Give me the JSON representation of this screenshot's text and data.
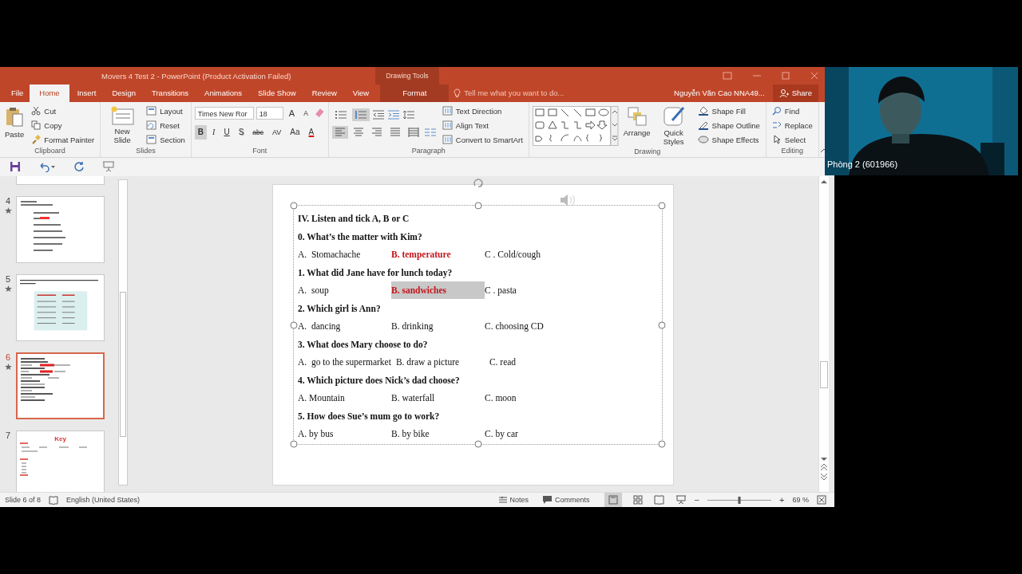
{
  "window": {
    "title": "Movers 4 Test 2 - PowerPoint (Product Activation Failed)",
    "context_title": "Drawing Tools"
  },
  "tabs": [
    {
      "label": "File",
      "selected": false,
      "kind": "standard"
    },
    {
      "label": "Home",
      "selected": true,
      "kind": "standard"
    },
    {
      "label": "Insert",
      "selected": false,
      "kind": "standard"
    },
    {
      "label": "Design",
      "selected": false,
      "kind": "standard"
    },
    {
      "label": "Transitions",
      "selected": false,
      "kind": "standard"
    },
    {
      "label": "Animations",
      "selected": false,
      "kind": "standard"
    },
    {
      "label": "Slide Show",
      "selected": false,
      "kind": "standard"
    },
    {
      "label": "Review",
      "selected": false,
      "kind": "standard"
    },
    {
      "label": "View",
      "selected": false,
      "kind": "standard"
    },
    {
      "label": "Format",
      "selected": false,
      "kind": "contextual"
    }
  ],
  "tell_me": {
    "placeholder": "Tell me what you want to do..."
  },
  "user": "Nguyễn Văn Cao NNA49...",
  "share": "Share",
  "ribbon": {
    "clipboard": {
      "label": "Clipboard",
      "paste": "Paste",
      "items": [
        "Cut",
        "Copy",
        "Format Painter"
      ]
    },
    "slides": {
      "label": "Slides",
      "new_slide": "New Slide",
      "items": [
        "Layout",
        "Reset",
        "Section"
      ]
    },
    "font": {
      "label": "Font",
      "font_name": "Times New Ror",
      "font_size": "18",
      "size_buttons": [
        "A",
        "A"
      ],
      "buttons": [
        {
          "label": "B",
          "on": true
        },
        {
          "label": "I",
          "on": false
        },
        {
          "label": "U",
          "on": false
        },
        {
          "label": "S",
          "on": false
        },
        {
          "label": "abc",
          "on": false
        },
        {
          "label": "AV",
          "on": false
        },
        {
          "label": "Aa",
          "on": false
        },
        {
          "label": "A",
          "on": false
        }
      ]
    },
    "paragraph": {
      "label": "Paragraph",
      "list_buttons": [
        {
          "on": false
        },
        {
          "on": true
        }
      ],
      "align_buttons": [
        {
          "on": true
        },
        {
          "on": false
        },
        {
          "on": false
        },
        {
          "on": false
        },
        {
          "on": false
        }
      ],
      "items": [
        "Text Direction",
        "Align Text",
        "Convert to SmartArt"
      ]
    },
    "drawing": {
      "label": "Drawing",
      "arrange": "Arrange",
      "quick_styles": "Quick Styles",
      "items": [
        "Shape Fill",
        "Shape Outline",
        "Shape Effects"
      ]
    },
    "editing": {
      "label": "Editing",
      "items": [
        "Find",
        "Replace",
        "Select"
      ]
    }
  },
  "thumbnails": [
    {
      "kind": "partial",
      "selected": false,
      "animated": false
    },
    {
      "number": "4",
      "kind": "worksheet",
      "selected": false,
      "animated": true
    },
    {
      "number": "5",
      "kind": "table",
      "selected": false,
      "animated": true
    },
    {
      "number": "6",
      "kind": "quiz",
      "selected": true,
      "animated": true
    },
    {
      "number": "7",
      "kind": "key",
      "title": "Key",
      "selected": false,
      "animated": false
    }
  ],
  "slide": {
    "lines": [
      {
        "kind": "question",
        "text": "IV. Listen and tick A, B or C"
      },
      {
        "kind": "question",
        "text": "0. What’s the matter with Kim?"
      },
      {
        "kind": "options",
        "options": [
          {
            "text": "A.  Stomachache",
            "correct": false,
            "highlighted": false
          },
          {
            "text": "B. temperature",
            "correct": true,
            "highlighted": false
          },
          {
            "text": "C . Cold/cough",
            "correct": false,
            "highlighted": false
          }
        ]
      },
      {
        "kind": "question",
        "text": "1. What did Jane have for lunch today?"
      },
      {
        "kind": "options",
        "options": [
          {
            "text": "A.  soup",
            "correct": false,
            "highlighted": false
          },
          {
            "text": "B. sandwiches",
            "correct": true,
            "highlighted": true
          },
          {
            "text": "C . pasta",
            "correct": false,
            "highlighted": false
          }
        ]
      },
      {
        "kind": "question",
        "text": "2. Which girl is Ann?"
      },
      {
        "kind": "options",
        "options": [
          {
            "text": "A.  dancing",
            "correct": false,
            "highlighted": false
          },
          {
            "text": "B. drinking",
            "correct": false,
            "highlighted": false
          },
          {
            "text": "C. choosing CD",
            "correct": false,
            "highlighted": false
          }
        ]
      },
      {
        "kind": "question",
        "text": "3. What does Mary choose to do?"
      },
      {
        "kind": "options",
        "options": [
          {
            "text": "A.  go to the supermarket",
            "correct": false,
            "highlighted": false
          },
          {
            "text": "B. draw a picture",
            "correct": false,
            "highlighted": false
          },
          {
            "text": "C. read",
            "correct": false,
            "highlighted": false
          }
        ]
      },
      {
        "kind": "question",
        "text": "4. Which picture does Nick’s dad choose?"
      },
      {
        "kind": "options",
        "options": [
          {
            "text": "A. Mountain",
            "correct": false,
            "highlighted": false
          },
          {
            "text": "B. waterfall",
            "correct": false,
            "highlighted": false
          },
          {
            "text": "C. moon",
            "correct": false,
            "highlighted": false
          }
        ]
      },
      {
        "kind": "question",
        "text": "5. How does Sue’s mum go to work?"
      },
      {
        "kind": "options",
        "options": [
          {
            "text": "A. by bus",
            "correct": false,
            "highlighted": false
          },
          {
            "text": "B. by bike",
            "correct": false,
            "highlighted": false
          },
          {
            "text": "C. by car",
            "correct": false,
            "highlighted": false
          }
        ]
      }
    ]
  },
  "status_bar": {
    "slide": "Slide 6 of 8",
    "language": "English (United States)",
    "notes": "Notes",
    "comments": "Comments",
    "zoom_out": "−",
    "zoom_slider": {
      "level": 0.5
    },
    "zoom_in": "+",
    "zoom": "69 %"
  },
  "webcam": {
    "label": "Phòng 2 (601966)"
  }
}
